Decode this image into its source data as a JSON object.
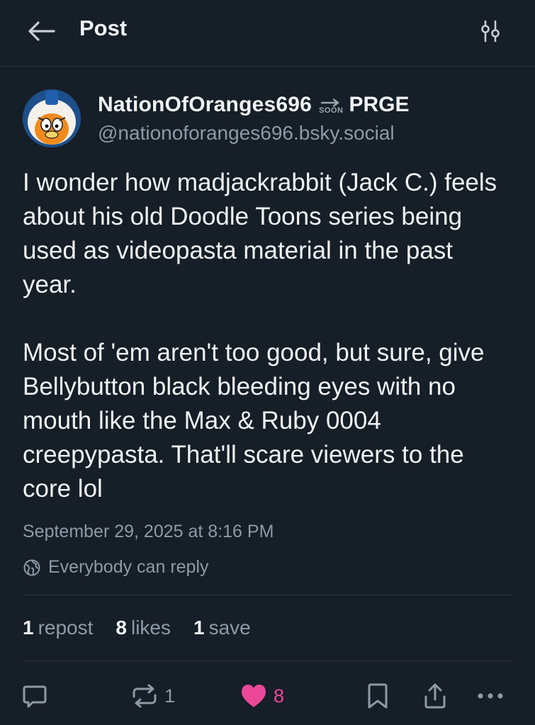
{
  "header": {
    "title": "Post",
    "back_icon": "arrow-left-icon",
    "filter_icon": "sliders-icon"
  },
  "author": {
    "display_name": "NationOfOranges696",
    "badge_text": "SOON",
    "display_suffix": "PRGE",
    "handle": "@nationoforanges696.bsky.social"
  },
  "post": {
    "paragraphs": [
      "I wonder how madjackrabbit (Jack C.) feels about his old Doodle Toons series being used as videopasta material in the past year.",
      "Most of 'em aren't too good, but sure, give Bellybutton black bleeding eyes with no mouth like the Max & Ruby 0004 creepypasta. That'll scare viewers to the core lol"
    ],
    "timestamp": "September 29, 2025 at 8:16 PM",
    "reply_setting": "Everybody can reply"
  },
  "stats": {
    "reposts_count": "1",
    "reposts_label": "repost",
    "likes_count": "8",
    "likes_label": "likes",
    "saves_count": "1",
    "saves_label": "save"
  },
  "actions": {
    "repost_count": "1",
    "like_count": "8"
  },
  "colors": {
    "background": "#161e27",
    "text": "#f1f3f5",
    "muted": "#8e9aa7",
    "like": "#ec4899",
    "divider": "#2a3440"
  }
}
